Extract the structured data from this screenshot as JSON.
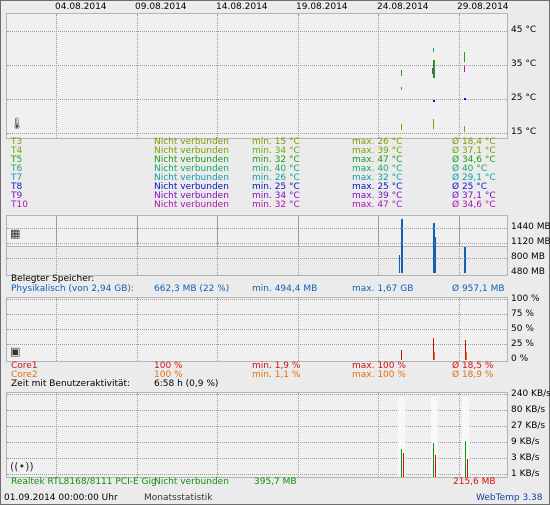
{
  "dates": [
    "04.08.2014",
    "09.08.2014",
    "14.08.2014",
    "19.08.2014",
    "24.08.2014",
    "29.08.2014"
  ],
  "temperature": {
    "axis": [
      "45 °C",
      "35 °C",
      "25 °C",
      "15 °C"
    ],
    "sensors": [
      {
        "name": "T3",
        "status": "Nicht verbunden",
        "min": "min. 15 °C",
        "max": "max. 26 °C",
        "avg": "Ø 18,4 °C",
        "color": "#8a9a00"
      },
      {
        "name": "T4",
        "status": "Nicht verbunden",
        "min": "min. 34 °C",
        "max": "max. 39 °C",
        "avg": "Ø 37,1 °C",
        "color": "#70a800"
      },
      {
        "name": "T5",
        "status": "Nicht verbunden",
        "min": "min. 32 °C",
        "max": "max. 47 °C",
        "avg": "Ø 34,6 °C",
        "color": "#1e9a1e"
      },
      {
        "name": "T6",
        "status": "Nicht verbunden",
        "min": "min. 40 °C",
        "max": "max. 40 °C",
        "avg": "Ø 40 °C",
        "color": "#1aa860"
      },
      {
        "name": "T7",
        "status": "Nicht verbunden",
        "min": "min. 26 °C",
        "max": "max. 32 °C",
        "avg": "Ø 29,1 °C",
        "color": "#10a0a8"
      },
      {
        "name": "T8",
        "status": "Nicht verbunden",
        "min": "min. 25 °C",
        "max": "max. 25 °C",
        "avg": "Ø 25 °C",
        "color": "#1010c8"
      },
      {
        "name": "T9",
        "status": "Nicht verbunden",
        "min": "min. 34 °C",
        "max": "max. 39 °C",
        "avg": "Ø 37,1 °C",
        "color": "#7a10c0"
      },
      {
        "name": "T10",
        "status": "Nicht verbunden",
        "min": "min. 32 °C",
        "max": "max. 47 °C",
        "avg": "Ø 34,6 °C",
        "color": "#b010b8"
      }
    ]
  },
  "memory": {
    "axis": [
      "1440 MB",
      "1120 MB",
      "800 MB",
      "480 MB"
    ],
    "heading": "Belegter Speicher:",
    "label": "Physikalisch (von 2,94 GB):",
    "current": "662,3 MB (22 %)",
    "min": "min. 494,4 MB",
    "max": "max. 1,67 GB",
    "avg": "Ø 957,1 MB",
    "color": "#1060b8"
  },
  "cpu": {
    "axis": [
      "100 %",
      "75 %",
      "50 %",
      "25 %",
      "0 %"
    ],
    "cores": [
      {
        "name": "Core1",
        "current": "100 %",
        "min": "min. 1,9 %",
        "max": "max. 100 %",
        "avg": "Ø 18,5 %",
        "color": "#d01010"
      },
      {
        "name": "Core2",
        "current": "100 %",
        "min": "min. 1,1 %",
        "max": "max. 100 %",
        "avg": "Ø 18,9 %",
        "color": "#e07010"
      }
    ],
    "activity_label": "Zeit mit Benutzeraktivität:",
    "activity_value": "6:58 h (0,9 %)"
  },
  "network": {
    "axis": [
      "240 KB/s",
      "80 KB/s",
      "27 KB/s",
      "9 KB/s",
      "3 KB/s",
      "1 KB/s"
    ],
    "adapter": "Realtek RTL8168/8111 PCI-E Gig",
    "status": "Nicht verbunden",
    "down": "395,7 MB",
    "up": "215,6 MB",
    "down_color": "#109010",
    "up_color": "#d01010"
  },
  "footer": {
    "timestamp": "01.09.2014 00:00:00 Uhr",
    "mode": "Monatsstatistik",
    "brand": "WebTemp 3.38"
  }
}
